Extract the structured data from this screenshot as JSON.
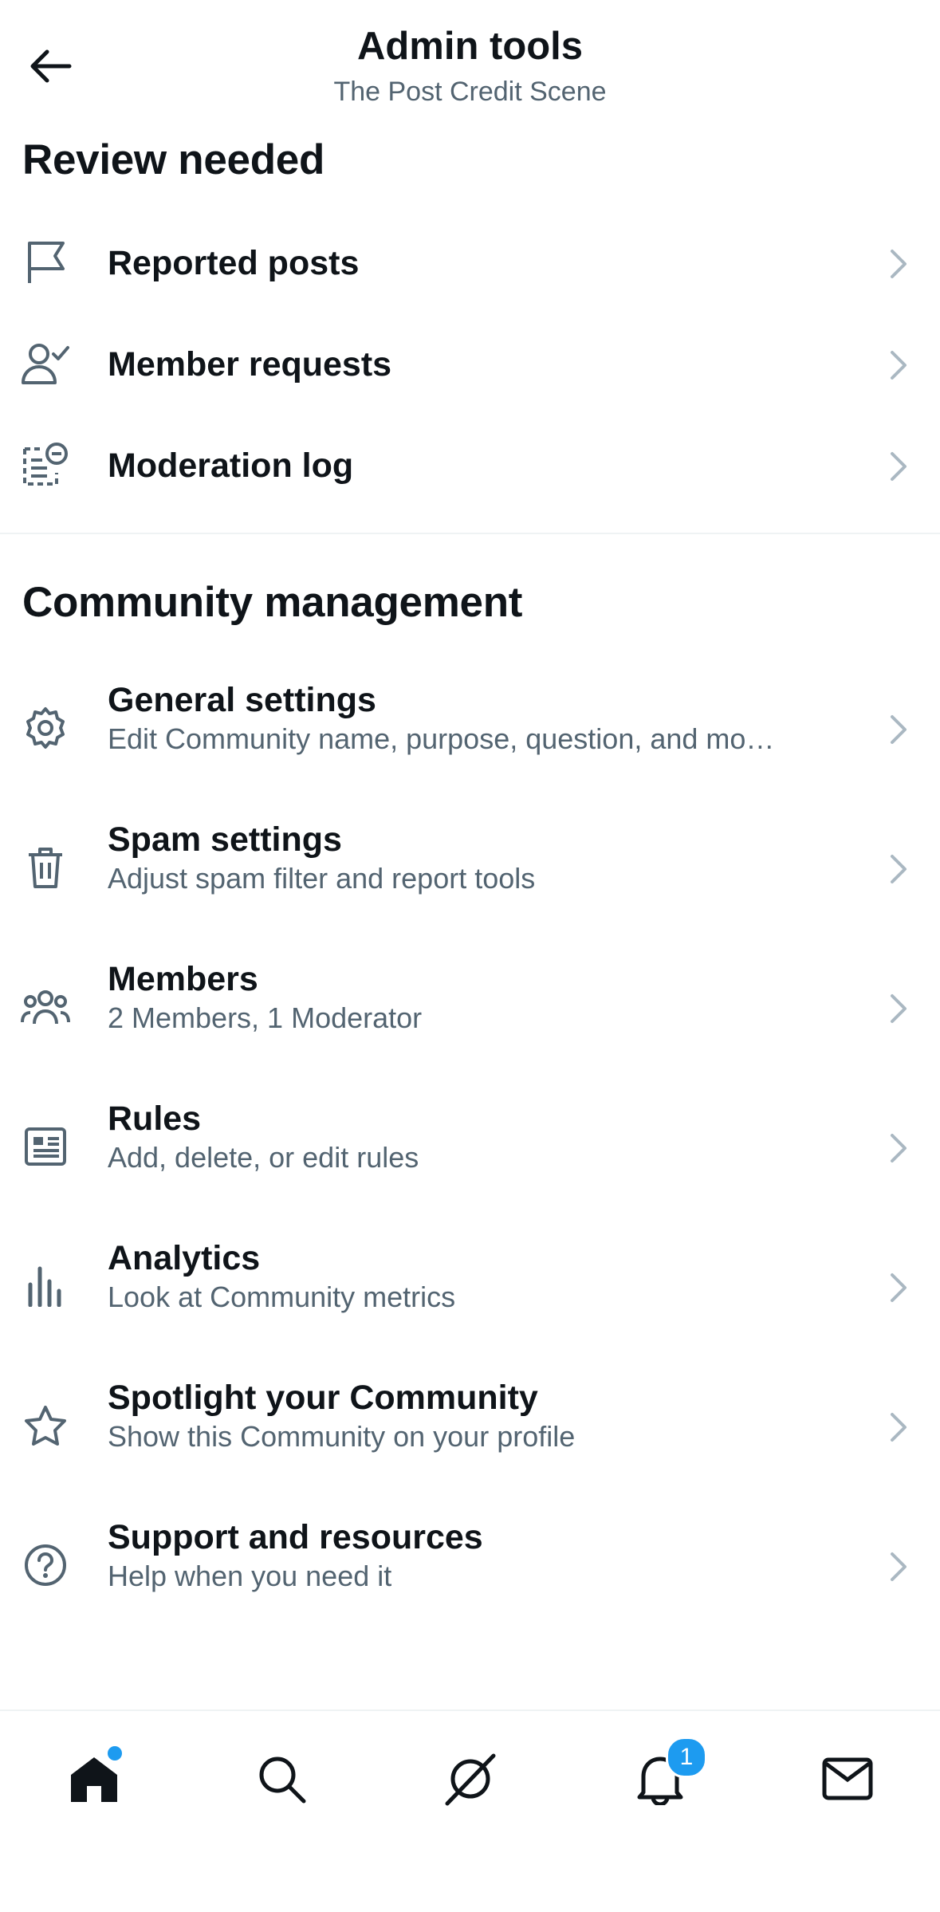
{
  "header": {
    "title": "Admin tools",
    "subtitle": "The Post Credit Scene",
    "back_icon": "back-arrow-icon"
  },
  "review": {
    "heading": "Review needed",
    "items": [
      {
        "label": "Reported posts",
        "icon": "flag-icon"
      },
      {
        "label": "Member requests",
        "icon": "person-check-icon"
      },
      {
        "label": "Moderation log",
        "icon": "moderation-log-icon"
      }
    ]
  },
  "management": {
    "heading": "Community management",
    "items": [
      {
        "label": "General settings",
        "sub": "Edit Community name, purpose, question, and mo…",
        "icon": "gear-icon"
      },
      {
        "label": "Spam settings",
        "sub": "Adjust spam filter and report tools",
        "icon": "trash-icon"
      },
      {
        "label": "Members",
        "sub": "2 Members, 1 Moderator",
        "icon": "people-icon"
      },
      {
        "label": "Rules",
        "sub": "Add, delete, or edit rules",
        "icon": "rules-icon"
      },
      {
        "label": "Analytics",
        "sub": "Look at Community metrics",
        "icon": "analytics-icon"
      },
      {
        "label": "Spotlight your Community",
        "sub": "Show this Community on your profile",
        "icon": "star-icon"
      },
      {
        "label": "Support and resources",
        "sub": "Help when you need it",
        "icon": "help-icon"
      }
    ]
  },
  "nav": {
    "tabs": [
      "home-icon",
      "search-icon",
      "grok-icon",
      "bell-icon",
      "mail-icon"
    ],
    "notification_badge": "1"
  },
  "colors": {
    "text": "#0f1419",
    "secondary": "#536471",
    "accent": "#1d9bf0",
    "chevron": "#aab8c2"
  }
}
